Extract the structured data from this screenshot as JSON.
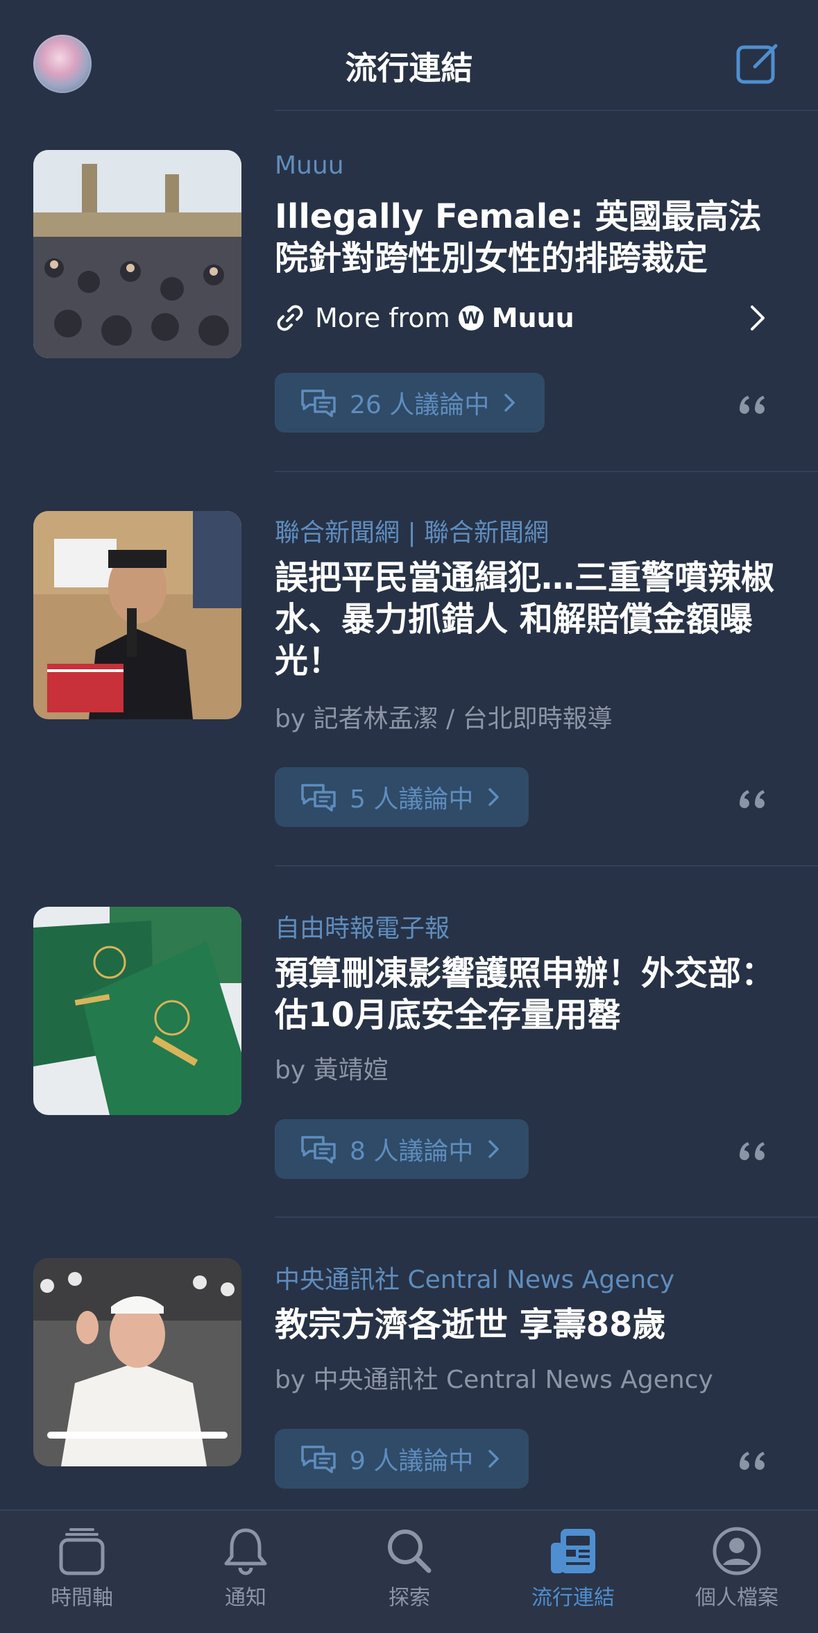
{
  "header": {
    "title": "流行連結"
  },
  "colors": {
    "background": "#273246",
    "accent": "#4f8fd0",
    "source": "#5f8dbd",
    "button_bg": "#2f4b68",
    "muted": "#8c95a6"
  },
  "feed": {
    "items": [
      {
        "source": "Muuu",
        "title": "Illegally Female: 英國最高法院針對跨性別女性的排跨裁定",
        "more_from_prefix": "More from",
        "more_from_name": "Muuu",
        "discussion": "26 人議論中",
        "image": "crowd-protest-westminster"
      },
      {
        "source": "聯合新聞網 | 聯合新聞網",
        "title": "誤把平民當通緝犯…三重警噴辣椒水、暴力抓錯人 和解賠償金額曝光！",
        "byline": "by 記者林孟潔 / 台北即時報導",
        "discussion": "5 人議論中",
        "image": "man-speaking-microphone-protest"
      },
      {
        "source": "自由時報電子報",
        "title": "預算刪凍影響護照申辦！外交部：估10月底安全存量用罄",
        "byline": "by 黃靖媗",
        "discussion": "8 人議論中",
        "image": "taiwan-passports"
      },
      {
        "source": "中央通訊社 Central News Agency",
        "title": "教宗方濟各逝世 享壽88歲",
        "byline": "by 中央通訊社 Central News Agency",
        "discussion": "9 人議論中",
        "image": "pope-waving"
      }
    ]
  },
  "tabbar": {
    "tabs": [
      {
        "label": "時間軸",
        "icon": "timeline-icon"
      },
      {
        "label": "通知",
        "icon": "bell-icon"
      },
      {
        "label": "探索",
        "icon": "search-icon"
      },
      {
        "label": "流行連結",
        "icon": "news-icon",
        "active": true
      },
      {
        "label": "個人檔案",
        "icon": "profile-icon"
      }
    ]
  }
}
